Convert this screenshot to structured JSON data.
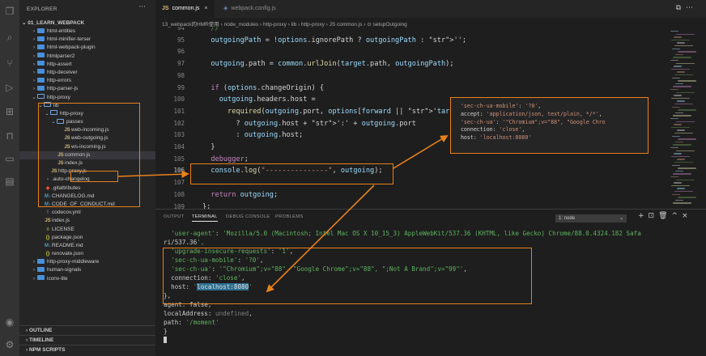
{
  "colors": {
    "accent_orange": "#e8811b",
    "folder_blue": "#4a90d9",
    "js_yellow": "#d7ba7d"
  },
  "sidebar": {
    "title": "EXPLORER",
    "more": "···",
    "section": "01_LEARN_WEBPACK",
    "tree": [
      {
        "label": "html-entities",
        "kind": "folder",
        "depth": 2,
        "open": false
      },
      {
        "label": "html-minifier-terser",
        "kind": "folder",
        "depth": 2,
        "open": false
      },
      {
        "label": "html-webpack-plugin",
        "kind": "folder",
        "depth": 2,
        "open": false
      },
      {
        "label": "htmlparser2",
        "kind": "folder",
        "depth": 2,
        "open": false
      },
      {
        "label": "http-assert",
        "kind": "folder",
        "depth": 2,
        "open": false
      },
      {
        "label": "http-deceiver",
        "kind": "folder",
        "depth": 2,
        "open": false
      },
      {
        "label": "http-errors",
        "kind": "folder",
        "depth": 2,
        "open": false
      },
      {
        "label": "http-parser-js",
        "kind": "folder",
        "depth": 2,
        "open": false
      },
      {
        "label": "http-proxy",
        "kind": "folder",
        "depth": 2,
        "open": true
      },
      {
        "label": "lib",
        "kind": "folder",
        "depth": 3,
        "open": true
      },
      {
        "label": "http-proxy",
        "kind": "folder",
        "depth": 4,
        "open": true
      },
      {
        "label": "passes",
        "kind": "folder",
        "depth": 5,
        "open": true
      },
      {
        "label": "web-incoming.js",
        "kind": "js",
        "depth": 6
      },
      {
        "label": "web-outgoing.js",
        "kind": "js",
        "depth": 6
      },
      {
        "label": "ws-incoming.js",
        "kind": "js",
        "depth": 6
      },
      {
        "label": "common.js",
        "kind": "js",
        "depth": 5,
        "active": true
      },
      {
        "label": "index.js",
        "kind": "js",
        "depth": 5
      },
      {
        "label": "http-proxy.js",
        "kind": "js",
        "depth": 4
      },
      {
        "label": ".auto-changelog",
        "kind": "file",
        "depth": 3
      },
      {
        "label": ".gitattributes",
        "kind": "git",
        "depth": 3
      },
      {
        "label": "CHANGELOG.md",
        "kind": "md",
        "depth": 3
      },
      {
        "label": "CODE_OF_CONDUCT.md",
        "kind": "md",
        "depth": 3
      },
      {
        "label": "codecov.yml",
        "kind": "yml",
        "depth": 3
      },
      {
        "label": "index.js",
        "kind": "js",
        "depth": 3
      },
      {
        "label": "LICENSE",
        "kind": "license",
        "depth": 3
      },
      {
        "label": "package.json",
        "kind": "json",
        "depth": 3
      },
      {
        "label": "README.md",
        "kind": "md",
        "depth": 3
      },
      {
        "label": "renovate.json",
        "kind": "json",
        "depth": 3
      },
      {
        "label": "http-proxy-middleware",
        "kind": "folder",
        "depth": 2,
        "open": false
      },
      {
        "label": "human-signals",
        "kind": "folder",
        "depth": 2,
        "open": false
      },
      {
        "label": "iconv-lite",
        "kind": "folder",
        "depth": 2,
        "open": false
      }
    ],
    "bottom": [
      "OUTLINE",
      "TIMELINE",
      "NPM SCRIPTS"
    ]
  },
  "tabs": [
    {
      "label": "common.js",
      "close": "×",
      "active": true
    },
    {
      "label": "webpack.config.js",
      "active": false
    }
  ],
  "breadcrumb": "13_webpack的HMR使用 › node_modules › http-proxy › lib › http-proxy › JS common.js › ⊙ setupOutgoing",
  "editor": {
    "lines": [
      {
        "n": "94",
        "text": "  //"
      },
      {
        "n": "95",
        "text": "  outgoingPath = !options.ignorePath ? outgoingPath : '';"
      },
      {
        "n": "96",
        "text": ""
      },
      {
        "n": "97",
        "text": "  outgoing.path = common.urlJoin(target.path, outgoingPath);"
      },
      {
        "n": "98",
        "text": ""
      },
      {
        "n": "99",
        "text": "  if (options.changeOrigin) {"
      },
      {
        "n": "100",
        "text": "    outgoing.headers.host ="
      },
      {
        "n": "101",
        "text": "      required(outgoing.port, options[forward || 'target']"
      },
      {
        "n": "102",
        "text": "        ? outgoing.host + ':' + outgoing.port"
      },
      {
        "n": "103",
        "text": "        : outgoing.host;"
      },
      {
        "n": "104",
        "text": "  }"
      },
      {
        "n": "105",
        "text": "  debugger;"
      },
      {
        "n": "106",
        "text": "  console.log(\"---------------\", outgoing);"
      },
      {
        "n": "107",
        "text": ""
      },
      {
        "n": "108",
        "text": "  return outgoing;"
      },
      {
        "n": "109",
        "text": "};"
      }
    ]
  },
  "popup": {
    "lines": [
      "  'sec-ch-ua-mobile': '?0',",
      "  accept: 'application/json, text/plain, */*',",
      "  'sec-ch-ua': '\"Chromium\";v=\"88\", \"Google Chro",
      "  connection: 'close',",
      "  host: 'localhost:8080'"
    ]
  },
  "panel": {
    "tabs": [
      "OUTPUT",
      "TERMINAL",
      "DEBUG CONSOLE",
      "PROBLEMS"
    ],
    "terminal_select": "1: node",
    "icons": [
      "+",
      "⊡",
      "🗑",
      "^",
      "×"
    ],
    "lines": [
      "  'user-agent': 'Mozilla/5.0 (Macintosh; Intel Mac OS X 10_15_3) AppleWebKit/537.36 (KHTML, like Gecko) Chrome/88.0.4324.182 Safa",
      "ri/537.36',",
      "  'upgrade-insecure-requests': '1',",
      "  'sec-ch-ua-mobile': '?0',",
      "  'sec-ch-ua': '\"Chromium\";v=\"88\", \"Google Chrome\";v=\"88\", \";Not A Brand\";v=\"99\"',",
      "  connection: 'close',",
      "  host: 'localhost:8080'",
      "},",
      "agent: false,",
      "localAddress: undefined,",
      "path: '/moment'",
      "}"
    ]
  }
}
